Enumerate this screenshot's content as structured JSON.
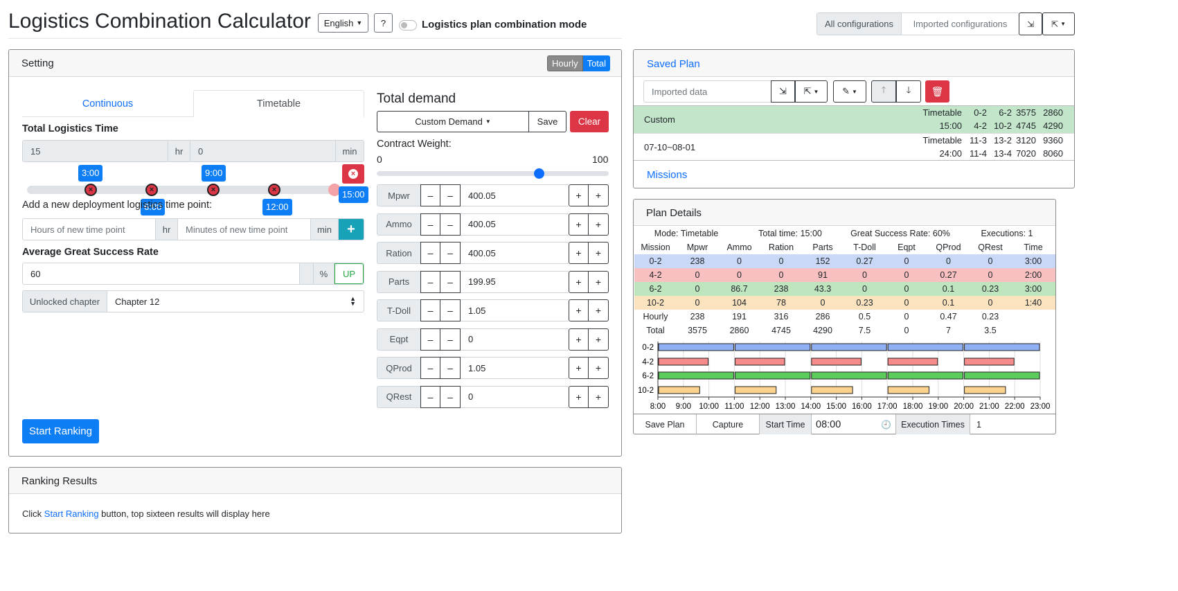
{
  "header": {
    "title": "Logistics Combination Calculator",
    "language": "English",
    "help": "?",
    "mode_label": "Logistics plan combination mode",
    "config_tabs": [
      "All configurations",
      "Imported configurations"
    ]
  },
  "setting": {
    "title": "Setting",
    "hourly": "Hourly",
    "total": "Total",
    "tabs": [
      "Continuous",
      "Timetable"
    ],
    "total_time_label": "Total Logistics Time",
    "hours_value": "15",
    "hr": "hr",
    "minutes_value": "0",
    "min": "min",
    "time_points": [
      "3:00",
      "6:00",
      "9:00",
      "12:00"
    ],
    "end_point": "15:00",
    "add_label": "Add a new deployment logistics time point:",
    "hours_placeholder": "Hours of new time point",
    "minutes_placeholder": "Minutes of new time point",
    "plus": "+",
    "success_label": "Average Great Success Rate",
    "success_value": "60",
    "percent": "%",
    "up": "UP",
    "chapter_label": "Unlocked chapter",
    "chapter_value": "Chapter 12",
    "start_ranking": "Start Ranking"
  },
  "demand": {
    "title": "Total demand",
    "custom": "Custom Demand",
    "save": "Save",
    "clear": "Clear",
    "weight_label": "Contract Weight:",
    "weight_min": "0",
    "weight_max": "100",
    "weight_value": 70,
    "minus": "–",
    "plus": "+",
    "resources": [
      {
        "name": "Mpwr",
        "value": "400.05"
      },
      {
        "name": "Ammo",
        "value": "400.05"
      },
      {
        "name": "Ration",
        "value": "400.05"
      },
      {
        "name": "Parts",
        "value": "199.95"
      },
      {
        "name": "T-Doll",
        "value": "1.05"
      },
      {
        "name": "Eqpt",
        "value": "0"
      },
      {
        "name": "QProd",
        "value": "1.05"
      },
      {
        "name": "QRest",
        "value": "0"
      }
    ]
  },
  "ranking": {
    "title": "Ranking Results",
    "msg_pre": "Click ",
    "msg_link": "Start Ranking",
    "msg_post": " button, top sixteen results will display here"
  },
  "saved": {
    "title": "Saved Plan",
    "import_placeholder": "Imported data",
    "missions": "Missions",
    "plans": [
      {
        "name": "Custom",
        "mode": "Timetable",
        "time": "15:00",
        "m1": "0-2",
        "m2": "6-2",
        "m3": "4-2",
        "m4": "10-2",
        "v1": "3575",
        "v2": "2860",
        "v3": "4745",
        "v4": "4290"
      },
      {
        "name": "07-10~08-01",
        "mode": "Timetable",
        "time": "24:00",
        "m1": "11-3",
        "m2": "13-2",
        "m3": "11-4",
        "m4": "13-4",
        "v1": "3120",
        "v2": "9360",
        "v3": "7020",
        "v4": "8060"
      }
    ]
  },
  "plan": {
    "title": "Plan Details",
    "summary": [
      "Mode: Timetable",
      "Total time: 15:00",
      "Great Success Rate: 60%",
      "Executions: 1"
    ],
    "columns": [
      "Mission",
      "Mpwr",
      "Ammo",
      "Ration",
      "Parts",
      "T-Doll",
      "Eqpt",
      "QProd",
      "QRest",
      "Time"
    ],
    "rows": [
      {
        "cells": [
          "0-2",
          "238",
          "0",
          "0",
          "152",
          "0.27",
          "0",
          "0",
          "0",
          "3:00"
        ],
        "color": "#c9d8f7"
      },
      {
        "cells": [
          "4-2",
          "0",
          "0",
          "0",
          "91",
          "0",
          "0",
          "0.27",
          "0",
          "2:00"
        ],
        "color": "#f8c0c0"
      },
      {
        "cells": [
          "6-2",
          "0",
          "86.7",
          "238",
          "43.3",
          "0",
          "0",
          "0.1",
          "0.23",
          "3:00"
        ],
        "color": "#bfe5bf"
      },
      {
        "cells": [
          "10-2",
          "0",
          "104",
          "78",
          "0",
          "0.23",
          "0",
          "0.1",
          "0",
          "1:40"
        ],
        "color": "#fbe3c0"
      },
      {
        "cells": [
          "Hourly",
          "238",
          "191",
          "316",
          "286",
          "0.5",
          "0",
          "0.47",
          "0.23",
          ""
        ],
        "color": "#ffffff"
      },
      {
        "cells": [
          "Total",
          "3575",
          "2860",
          "4745",
          "4290",
          "7.5",
          "0",
          "7",
          "3.5",
          ""
        ],
        "color": "#ffffff"
      }
    ],
    "gantt": {
      "missions": [
        "0-2",
        "4-2",
        "6-2",
        "10-2"
      ],
      "ticks": [
        "8:00",
        "9:00",
        "10:00",
        "11:00",
        "12:00",
        "13:00",
        "14:00",
        "15:00",
        "16:00",
        "17:00",
        "18:00",
        "19:00",
        "20:00",
        "21:00",
        "22:00",
        "23:00"
      ],
      "colors": [
        "#8fb0f2",
        "#f58b8b",
        "#5ccd5c",
        "#fbd38e"
      ],
      "bars": [
        [
          [
            0,
            3
          ],
          [
            3,
            6
          ],
          [
            6,
            9
          ],
          [
            9,
            12
          ],
          [
            12,
            15
          ]
        ],
        [
          [
            0,
            2
          ],
          [
            3,
            5
          ],
          [
            6,
            8
          ],
          [
            9,
            11
          ],
          [
            12,
            14
          ]
        ],
        [
          [
            0,
            3
          ],
          [
            3,
            6
          ],
          [
            6,
            9
          ],
          [
            9,
            12
          ],
          [
            12,
            15
          ]
        ],
        [
          [
            0,
            1.667
          ],
          [
            3,
            4.667
          ],
          [
            6,
            7.667
          ],
          [
            9,
            10.667
          ],
          [
            12,
            13.667
          ]
        ]
      ]
    },
    "footer": {
      "save_plan": "Save Plan",
      "capture": "Capture",
      "start_time_label": "Start Time",
      "start_time": "08:00",
      "exec_label": "Execution Times",
      "exec_value": "1"
    }
  }
}
